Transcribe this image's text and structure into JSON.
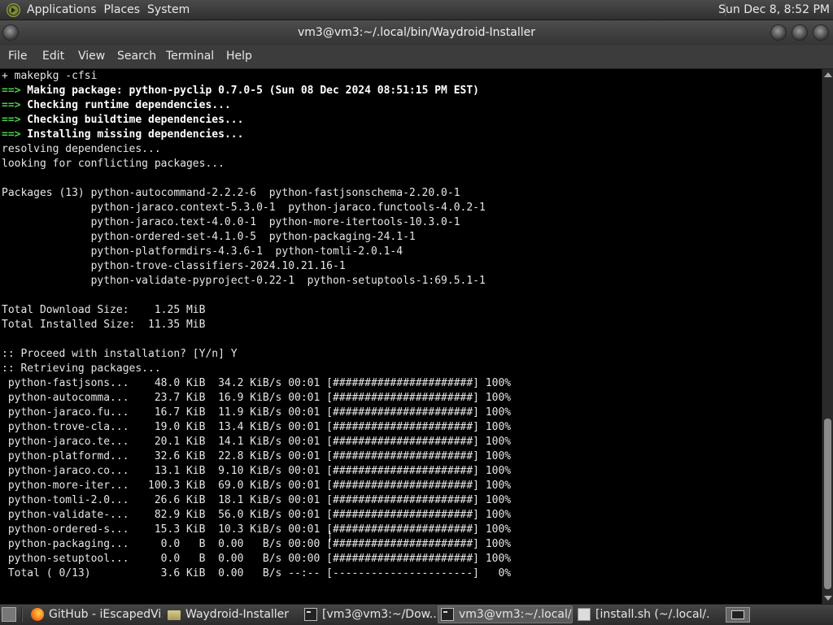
{
  "top_panel": {
    "menus": [
      "Applications",
      "Places",
      "System"
    ],
    "clock": "Sun Dec  8,  8:52 PM"
  },
  "window": {
    "title": "vm3@vm3:~/.local/bin/Waydroid-Installer"
  },
  "menu_bar": {
    "items": [
      "File",
      "Edit",
      "View",
      "Search",
      "Terminal",
      "Help"
    ]
  },
  "terminal": {
    "lines": [
      {
        "type": "plain",
        "text": "+ makepkg -cfsi"
      },
      {
        "type": "step",
        "arrow": "==>",
        "text": " Making package: python-pyclip 0.7.0-5 (Sun 08 Dec 2024 08:51:15 PM EST)"
      },
      {
        "type": "step",
        "arrow": "==>",
        "text": " Checking runtime dependencies..."
      },
      {
        "type": "step",
        "arrow": "==>",
        "text": " Checking buildtime dependencies..."
      },
      {
        "type": "step",
        "arrow": "==>",
        "text": " Installing missing dependencies..."
      },
      {
        "type": "plain",
        "text": "resolving dependencies..."
      },
      {
        "type": "plain",
        "text": "looking for conflicting packages..."
      },
      {
        "type": "plain",
        "text": ""
      },
      {
        "type": "plain",
        "text": "Packages (13) python-autocommand-2.2.2-6  python-fastjsonschema-2.20.0-1"
      },
      {
        "type": "plain",
        "text": "              python-jaraco.context-5.3.0-1  python-jaraco.functools-4.0.2-1"
      },
      {
        "type": "plain",
        "text": "              python-jaraco.text-4.0.0-1  python-more-itertools-10.3.0-1"
      },
      {
        "type": "plain",
        "text": "              python-ordered-set-4.1.0-5  python-packaging-24.1-1"
      },
      {
        "type": "plain",
        "text": "              python-platformdirs-4.3.6-1  python-tomli-2.0.1-4"
      },
      {
        "type": "plain",
        "text": "              python-trove-classifiers-2024.10.21.16-1"
      },
      {
        "type": "plain",
        "text": "              python-validate-pyproject-0.22-1  python-setuptools-1:69.5.1-1"
      },
      {
        "type": "plain",
        "text": ""
      },
      {
        "type": "plain",
        "text": "Total Download Size:    1.25 MiB"
      },
      {
        "type": "plain",
        "text": "Total Installed Size:  11.35 MiB"
      },
      {
        "type": "plain",
        "text": ""
      },
      {
        "type": "plain",
        "text": ":: Proceed with installation? [Y/n] Y"
      },
      {
        "type": "plain",
        "text": ":: Retrieving packages..."
      },
      {
        "type": "plain",
        "text": " python-fastjsons...    48.0 KiB  34.2 KiB/s 00:01 [######################] 100%"
      },
      {
        "type": "plain",
        "text": " python-autocomma...    23.7 KiB  16.9 KiB/s 00:01 [######################] 100%"
      },
      {
        "type": "plain",
        "text": " python-jaraco.fu...    16.7 KiB  11.9 KiB/s 00:01 [######################] 100%"
      },
      {
        "type": "plain",
        "text": " python-trove-cla...    19.0 KiB  13.4 KiB/s 00:01 [######################] 100%"
      },
      {
        "type": "plain",
        "text": " python-jaraco.te...    20.1 KiB  14.1 KiB/s 00:01 [######################] 100%"
      },
      {
        "type": "plain",
        "text": " python-platformd...    32.6 KiB  22.8 KiB/s 00:01 [######################] 100%"
      },
      {
        "type": "plain",
        "text": " python-jaraco.co...    13.1 KiB  9.10 KiB/s 00:01 [######################] 100%"
      },
      {
        "type": "plain",
        "text": " python-more-iter...   100.3 KiB  69.0 KiB/s 00:01 [######################] 100%"
      },
      {
        "type": "plain",
        "text": " python-tomli-2.0...    26.6 KiB  18.1 KiB/s 00:01 [######################] 100%"
      },
      {
        "type": "plain",
        "text": " python-validate-...    82.9 KiB  56.0 KiB/s 00:01 [######################] 100%"
      },
      {
        "type": "plain",
        "text": " python-ordered-s...    15.3 KiB  10.3 KiB/s 00:01 [######################] 100%"
      },
      {
        "type": "plain",
        "text": " python-packaging...     0.0   B  0.00   B/s 00:00 [######################] 100%"
      },
      {
        "type": "plain",
        "text": " python-setuptool...     0.0   B  0.00   B/s 00:00 [######################] 100%"
      },
      {
        "type": "plain",
        "text": " Total ( 0/13)           3.6 KiB  0.00   B/s --:-- [----------------------]   0%"
      }
    ]
  },
  "taskbar": {
    "tasks": [
      {
        "label": "GitHub - iEscapedVi...",
        "icon": "firefox-icon",
        "active": false
      },
      {
        "label": "Waydroid-Installer",
        "icon": "folder-icon",
        "active": false
      },
      {
        "label": "[vm3@vm3:~/Dow...",
        "icon": "terminal-icon",
        "active": false
      },
      {
        "label": "vm3@vm3:~/.local/...",
        "icon": "terminal-icon",
        "active": true
      },
      {
        "label": "[install.sh (~/.local/...",
        "icon": "text-editor-icon",
        "active": false
      }
    ]
  },
  "colors": {
    "terminal_bg": "#000000",
    "terminal_fg": "#e6e6e6",
    "arrow_green": "#4ccf4c"
  }
}
